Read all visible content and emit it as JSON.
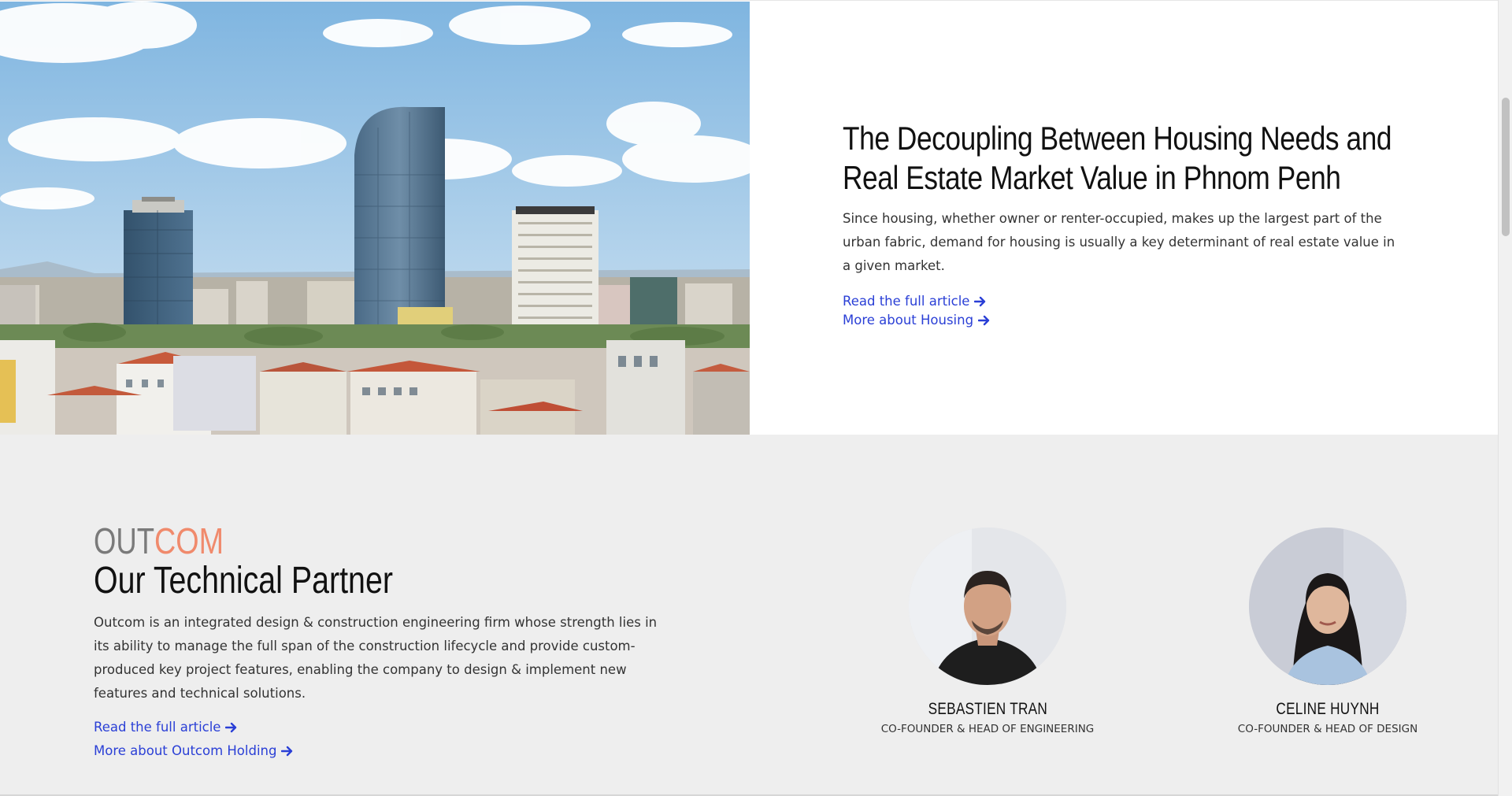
{
  "hero": {
    "image_alt": "Phnom Penh skyline",
    "title": "The Decoupling Between Housing Needs and Real Estate Market Value in Phnom Penh",
    "text": "Since housing, whether owner or renter-occupied, makes up the largest part of the urban fabric, demand for housing is usually a key determinant of real estate value in a given market.",
    "links": {
      "read_article": "Read the full article",
      "more_about": "More about Housing"
    }
  },
  "partner": {
    "logo": {
      "part1": "OUT",
      "part2": "COM"
    },
    "title": "Our Technical Partner",
    "text": "Outcom is an integrated design & construction engineering firm whose strength lies in its ability to manage the full span of the construction lifecycle and provide custom-produced key project features, enabling the company to design & implement new features and technical solutions.",
    "links": {
      "read_article": "Read the full article",
      "more_about": "More about Outcom Holding"
    },
    "team": [
      {
        "name": "SEBASTIEN TRAN",
        "role": "CO-FOUNDER & HEAD OF ENGINEERING"
      },
      {
        "name": "CELINE HUYNH",
        "role": "CO-FOUNDER & HEAD OF DESIGN"
      }
    ]
  },
  "colors": {
    "link": "#2a3fd6",
    "logo_gray": "#7a7a7a",
    "logo_accent": "#f08a6c",
    "section_bg": "#eeeeee"
  },
  "icons": [
    "arrow-right-icon"
  ]
}
